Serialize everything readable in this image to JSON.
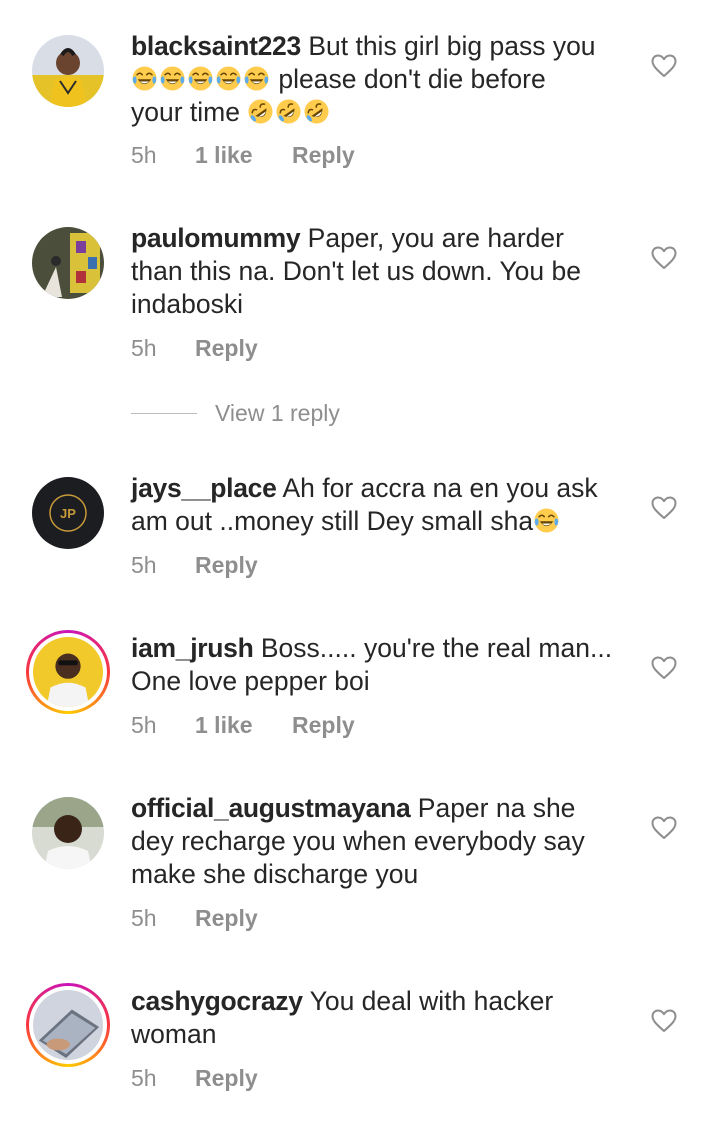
{
  "comments": [
    {
      "username": "blacksaint223",
      "text_parts": [
        "But this girl big pass you",
        "please don't die before",
        "your time"
      ],
      "time": "5h",
      "likes": "1 like",
      "reply": "Reply",
      "icons": {
        "emoji_line1": "face-with-tears-of-joy-icon",
        "emoji_line3": "rolling-on-floor-laughing-icon"
      }
    },
    {
      "username": "paulomummy",
      "text": "Paper, you are harder",
      "text2": "than this na. Don't let us down. You be",
      "text3": "indaboski",
      "time": "5h",
      "reply": "Reply",
      "view_replies": "View 1 reply"
    },
    {
      "username": "jays__place",
      "text": "Ah for accra na en you ask",
      "text2": "am out ..money still Dey small sha",
      "time": "5h",
      "reply": "Reply"
    },
    {
      "username": "iam_jrush",
      "text": "Boss..... you're the real man...",
      "text2": "One love pepper boi",
      "time": "5h",
      "likes": "1 like",
      "reply": "Reply"
    },
    {
      "username": "official_augustmayana",
      "text": "Paper na she",
      "text2": "dey recharge you when everybody say",
      "text3": "make she discharge you",
      "time": "5h",
      "reply": "Reply"
    },
    {
      "username": "cashygocrazy",
      "text": "You deal with hacker",
      "text2": "woman",
      "time": "5h",
      "reply": "Reply"
    }
  ],
  "colors": {
    "text": "#262626",
    "muted": "#8e8e8e",
    "story_ring": [
      "#c913b9",
      "#f9373f",
      "#fecd00"
    ]
  },
  "icons": {
    "like": "heart-outline-icon"
  }
}
